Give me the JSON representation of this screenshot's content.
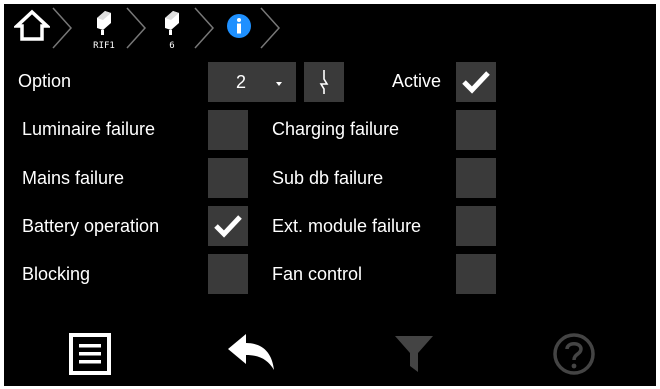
{
  "breadcrumb": {
    "items": [
      {
        "icon": "home-icon"
      },
      {
        "icon": "device-icon",
        "label": "RIF1"
      },
      {
        "icon": "device-icon",
        "label": "6"
      },
      {
        "icon": "info-icon"
      }
    ],
    "accent": "#1e90ff"
  },
  "option": {
    "label": "Option",
    "value": "2",
    "active_label": "Active",
    "active_checked": true
  },
  "left_rows": [
    {
      "label": "Luminaire failure",
      "checked": false
    },
    {
      "label": "Mains failure",
      "checked": false
    },
    {
      "label": "Battery operation",
      "checked": true
    },
    {
      "label": "Blocking",
      "checked": false
    }
  ],
  "right_rows": [
    {
      "label": "Charging failure",
      "checked": false
    },
    {
      "label": "Sub db failure",
      "checked": false
    },
    {
      "label": "Ext. module failure",
      "checked": false
    },
    {
      "label": "Fan control",
      "checked": false
    }
  ],
  "bottom": {
    "icons": [
      "list-icon",
      "back-icon",
      "filter-icon",
      "help-icon"
    ]
  },
  "colors": {
    "background": "#000000",
    "box": "#3a3a3a",
    "disabled": "#444444",
    "text": "#ffffff"
  }
}
